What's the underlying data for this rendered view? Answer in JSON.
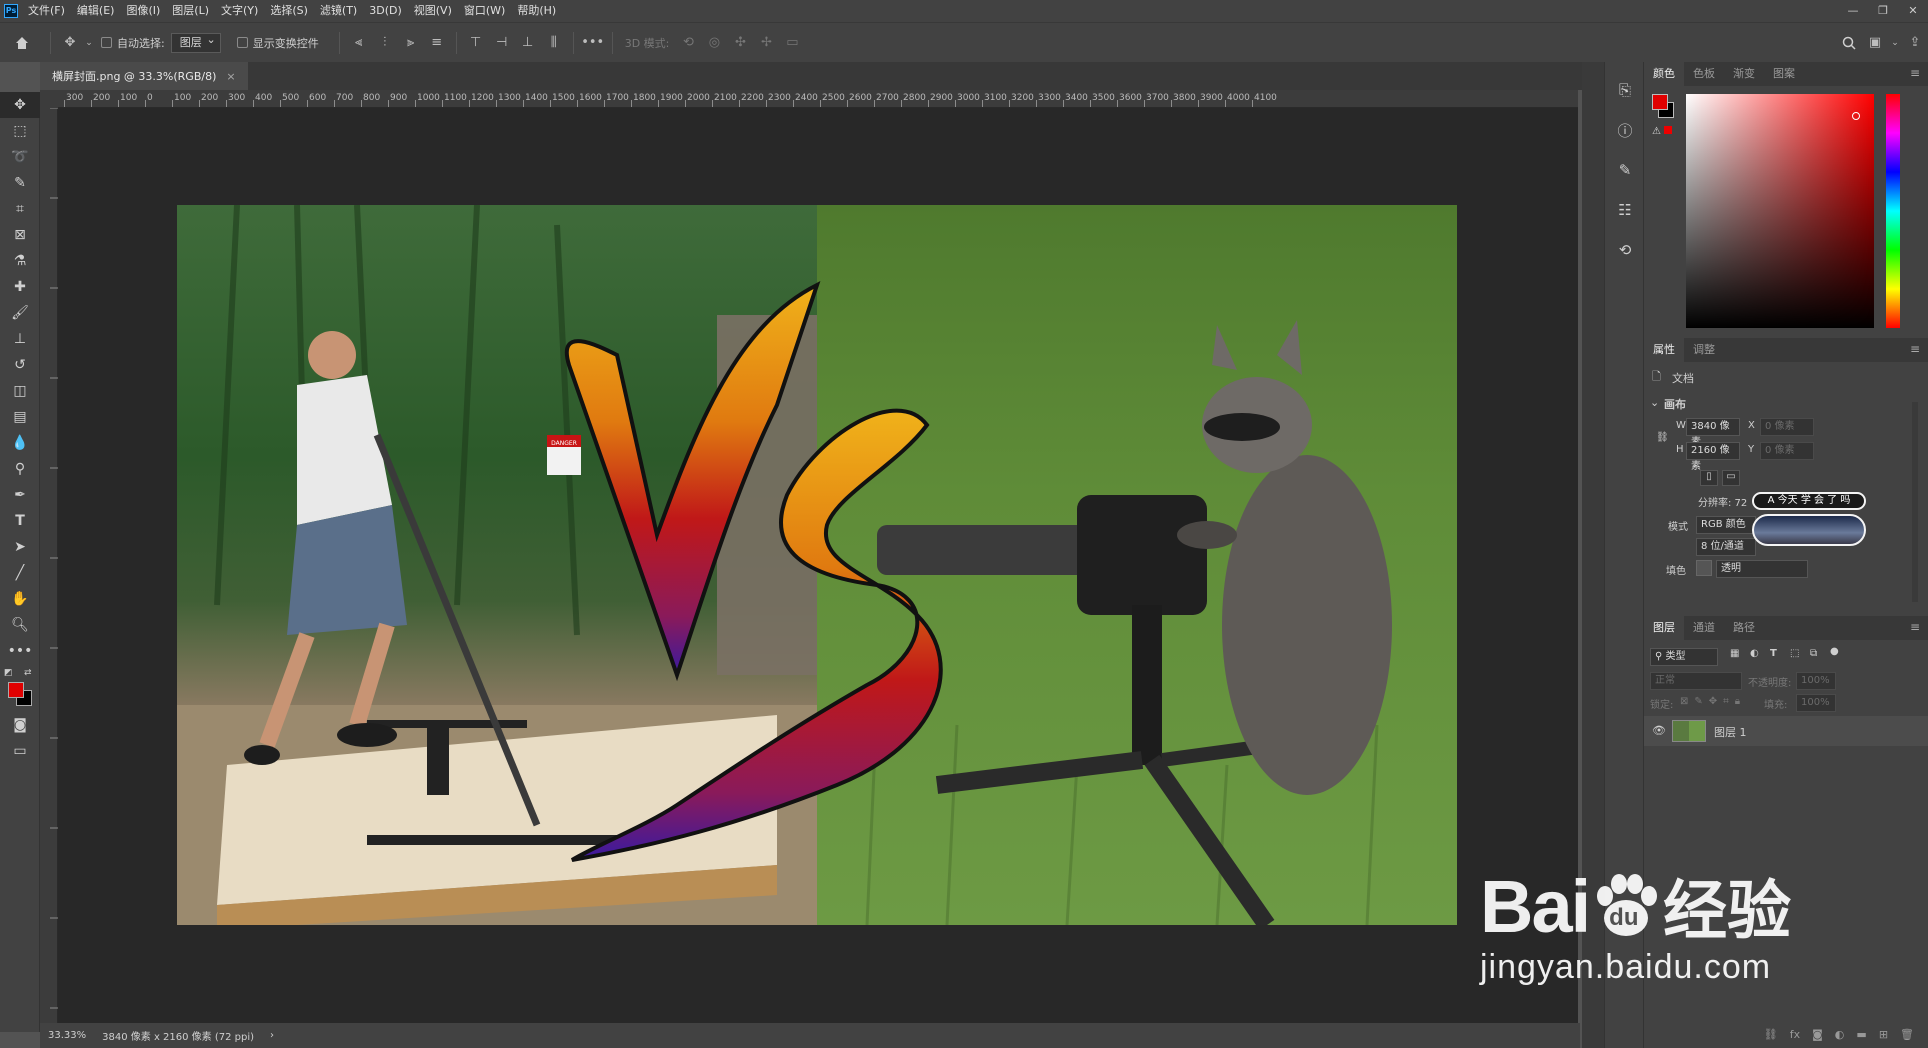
{
  "app": {
    "logo": "Ps"
  },
  "menu": [
    "文件(F)",
    "编辑(E)",
    "图像(I)",
    "图层(L)",
    "文字(Y)",
    "选择(S)",
    "滤镜(T)",
    "3D(D)",
    "视图(V)",
    "窗口(W)",
    "帮助(H)"
  ],
  "window_controls": {
    "minimize": "—",
    "restore": "❐",
    "close": "✕"
  },
  "options": {
    "auto_select_label": "自动选择:",
    "auto_select_value": "图层",
    "show_transform_label": "显示变换控件",
    "mode_3d_label": "3D 模式:"
  },
  "document_tab": {
    "title": "横屏封面.png @ 33.3%(RGB/8)",
    "close": "×"
  },
  "ruler": {
    "labels": [
      "300",
      "200",
      "100",
      "0",
      "100",
      "200",
      "300",
      "400",
      "500",
      "600",
      "700",
      "800",
      "900",
      "1000",
      "1100",
      "1200",
      "1300",
      "1400",
      "1500",
      "1600",
      "1700",
      "1800",
      "1900",
      "2000",
      "2100",
      "2200",
      "2300",
      "2400",
      "2500",
      "2600",
      "2700",
      "2800",
      "2900",
      "3000",
      "3100",
      "3200",
      "3300",
      "3400",
      "3500",
      "3600",
      "3700",
      "3800",
      "3900",
      "4000",
      "4100"
    ]
  },
  "canvas": {
    "vs_text": "VS",
    "sign_text": "DANGER",
    "sign_sub": "RESTRICTED AREA"
  },
  "status": {
    "zoom": "33.33%",
    "info": "3840 像素 x 2160 像素 (72 ppi)",
    "arrow": "›"
  },
  "color_panel": {
    "tabs": [
      "颜色",
      "色板",
      "渐变",
      "图案"
    ],
    "foreground": "#e00000",
    "background": "#000000"
  },
  "properties_panel": {
    "tabs": [
      "属性",
      "调整"
    ],
    "doc_label": "文档",
    "canvas_header": "画布",
    "width_label": "W",
    "width_value": "3840 像素",
    "height_label": "H",
    "height_value": "2160 像素",
    "x_label": "X",
    "x_value": "0 像素",
    "y_label": "Y",
    "y_value": "0 像素",
    "resolution": "分辨率: 72 像素/英寸",
    "mode_label": "模式",
    "mode_value": "RGB 颜色",
    "depth_value": "8 位/通道",
    "fill_label": "填色",
    "fill_value": "透明",
    "overlay_text": "A 今天 学 会 了 吗"
  },
  "layers_panel": {
    "tabs": [
      "图层",
      "通道",
      "路径"
    ],
    "filter_label": "类型",
    "blend_mode": "正常",
    "opacity_label": "不透明度:",
    "opacity_value": "100%",
    "lock_label": "锁定:",
    "fill_label": "填充:",
    "fill_value": "100%",
    "layer_name": "图层 1"
  },
  "watermark": {
    "brand": "Bai",
    "brand2": "du",
    "cn": "经验",
    "url": "jingyan.baidu.com"
  }
}
